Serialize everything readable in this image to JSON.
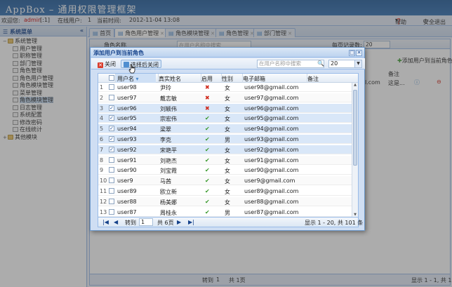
{
  "app": {
    "title": "AppBox  –  通用权限管理框架"
  },
  "status": {
    "welcome_prefix": "欢迎您:",
    "user": "admin",
    "user_suffix": "[:1]",
    "online_prefix": "在线用户:",
    "online_count": "1",
    "time_prefix": "当前时间:",
    "time": "2012-11-04 13:08"
  },
  "header_buttons": {
    "help": "帮助",
    "logout": "安全退出"
  },
  "sidebar": {
    "title": "系统菜单",
    "items": [
      {
        "label": "系统管理",
        "level": 0,
        "type": "folder",
        "expanded": true
      },
      {
        "label": "用户管理",
        "level": 1,
        "type": "leaf"
      },
      {
        "label": "职称管理",
        "level": 1,
        "type": "leaf"
      },
      {
        "label": "部门管理",
        "level": 1,
        "type": "leaf"
      },
      {
        "label": "角色管理",
        "level": 1,
        "type": "leaf"
      },
      {
        "label": "角色用户管理",
        "level": 1,
        "type": "leaf"
      },
      {
        "label": "角色模块管理",
        "level": 1,
        "type": "leaf"
      },
      {
        "label": "菜单管理",
        "level": 1,
        "type": "leaf"
      },
      {
        "label": "角色模块管理",
        "level": 1,
        "type": "leaf",
        "selected": true
      },
      {
        "label": "日志管理",
        "level": 1,
        "type": "leaf"
      },
      {
        "label": "系统配置",
        "level": 1,
        "type": "leaf"
      },
      {
        "label": "修改密码",
        "level": 1,
        "type": "leaf"
      },
      {
        "label": "在线统计",
        "level": 1,
        "type": "leaf"
      },
      {
        "label": "其他模块",
        "level": 0,
        "type": "folder",
        "expanded": false
      }
    ]
  },
  "tabs": [
    {
      "label": "首页",
      "active": false,
      "closable": false
    },
    {
      "label": "角色用户管理",
      "active": true,
      "closable": true
    },
    {
      "label": "角色模块管理",
      "active": false,
      "closable": true
    },
    {
      "label": "角色管理",
      "active": false,
      "closable": true
    },
    {
      "label": "部门管理",
      "active": false,
      "closable": true
    }
  ],
  "background": {
    "role_name_label": "角色名称",
    "search_placeholder": "在用户名称中搜索",
    "page_size_label": "每页记录数:",
    "page_size": "20",
    "add_button": "添加用户到当前角色",
    "remark_header": "备注",
    "cell_email_fragment": "l.com",
    "cell_remark_fragment": "这是...",
    "pager_goto": "转到",
    "pager_page": "1",
    "pager_total": "共 1页",
    "pager_info": "显示 1 - 1, 共 1 条"
  },
  "dialog": {
    "title": "添加用户到当前角色",
    "close_button": "关闭",
    "select_close_button": "选择后关闭",
    "search_placeholder": "在用户名称中搜索",
    "page_size": "20",
    "columns": [
      "用户名",
      "真实姓名",
      "启用",
      "性别",
      "电子邮箱",
      "备注"
    ],
    "rows": [
      {
        "checked": false,
        "username": "user98",
        "realname": "尹玲",
        "enabled": false,
        "gender": "女",
        "email": "user98@gmail.com",
        "selected": false
      },
      {
        "checked": false,
        "username": "user97",
        "realname": "戴志敏",
        "enabled": false,
        "gender": "女",
        "email": "user97@gmail.com",
        "selected": false
      },
      {
        "checked": true,
        "username": "user96",
        "realname": "刘颖伟",
        "enabled": false,
        "gender": "女",
        "email": "user96@gmail.com",
        "selected": true
      },
      {
        "checked": true,
        "username": "user95",
        "realname": "宗宏伟",
        "enabled": true,
        "gender": "女",
        "email": "user95@gmail.com",
        "selected": true
      },
      {
        "checked": true,
        "username": "user94",
        "realname": "梁翠",
        "enabled": true,
        "gender": "女",
        "email": "user94@gmail.com",
        "selected": true
      },
      {
        "checked": true,
        "username": "user93",
        "realname": "李克",
        "enabled": true,
        "gender": "男",
        "email": "user93@gmail.com",
        "selected": true
      },
      {
        "checked": true,
        "username": "user92",
        "realname": "宋艳平",
        "enabled": true,
        "gender": "女",
        "email": "user92@gmail.com",
        "selected": true
      },
      {
        "checked": false,
        "username": "user91",
        "realname": "刘艳杰",
        "enabled": true,
        "gender": "女",
        "email": "user91@gmail.com",
        "selected": false
      },
      {
        "checked": false,
        "username": "user90",
        "realname": "刘宝霞",
        "enabled": true,
        "gender": "女",
        "email": "user90@gmail.com",
        "selected": false
      },
      {
        "checked": false,
        "username": "user9",
        "realname": "马茜",
        "enabled": true,
        "gender": "女",
        "email": "user9@gmail.com",
        "selected": false
      },
      {
        "checked": false,
        "username": "user89",
        "realname": "欧立新",
        "enabled": true,
        "gender": "女",
        "email": "user89@gmail.com",
        "selected": false
      },
      {
        "checked": false,
        "username": "user88",
        "realname": "杨美娜",
        "enabled": true,
        "gender": "女",
        "email": "user88@gmail.com",
        "selected": false
      },
      {
        "checked": false,
        "username": "user87",
        "realname": "周桂永",
        "enabled": true,
        "gender": "男",
        "email": "user87@gmail.com",
        "selected": false
      }
    ],
    "pager": {
      "goto_label": "转到",
      "current_page": "1",
      "total_pages": "共 6页",
      "info": "显示 1 - 20, 共 101 条"
    }
  },
  "icons": {
    "enabled_yes": "✔",
    "enabled_no": "✖",
    "check": "✓"
  },
  "colors": {
    "header": "#2f6db0",
    "accent": "#15428b",
    "ok": "#3a9a2c",
    "no": "#d0281a"
  }
}
